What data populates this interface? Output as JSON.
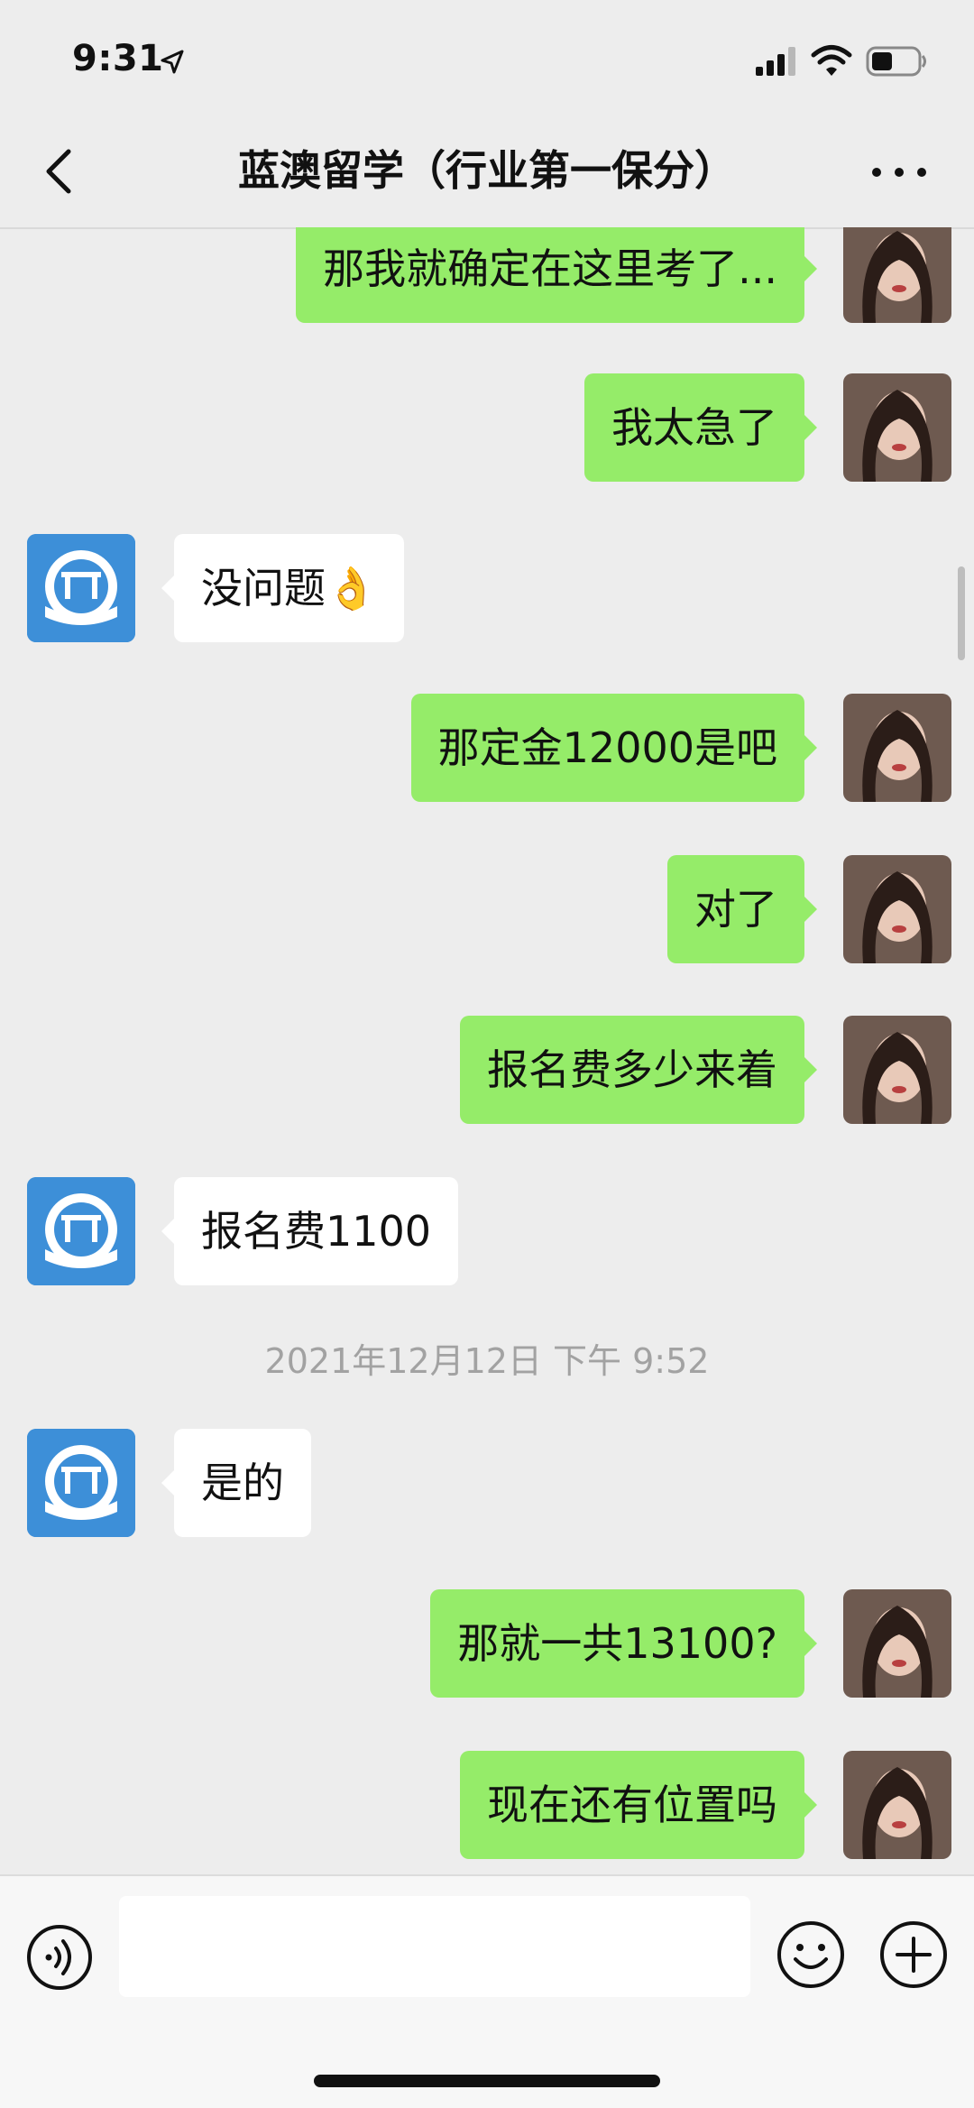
{
  "status_bar": {
    "time": "9:31"
  },
  "header": {
    "title": "蓝澳留学（行业第一保分）"
  },
  "messages": [
    {
      "side": "out",
      "text": "那我就确定在这里考了..."
    },
    {
      "side": "out",
      "text": "我太急了"
    },
    {
      "side": "in",
      "text": "没问题👌"
    },
    {
      "side": "out",
      "text": "那定金12000是吧"
    },
    {
      "side": "out",
      "text": "对了"
    },
    {
      "side": "out",
      "text": "报名费多少来着"
    },
    {
      "side": "in",
      "text": "报名费1100"
    },
    {
      "side": "in",
      "text": "是的"
    },
    {
      "side": "out",
      "text": "那就一共13100?"
    },
    {
      "side": "out",
      "text": "现在还有位置吗"
    }
  ],
  "timestamp": "2021年12月12日 下午 9:52",
  "input": {
    "value": "",
    "icons": [
      "voice-icon",
      "emoji-icon",
      "plus-icon"
    ]
  },
  "colors": {
    "background": "#ededed",
    "outgoing_bubble": "#95ec69",
    "incoming_bubble": "#ffffff",
    "org_avatar": "#3d8fd8"
  }
}
